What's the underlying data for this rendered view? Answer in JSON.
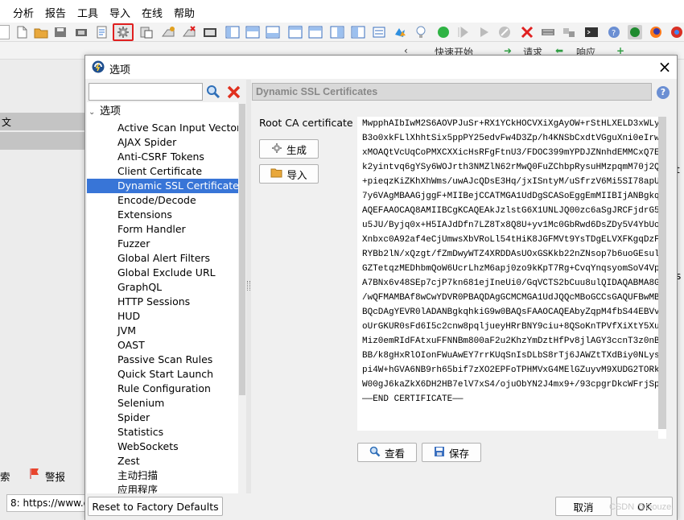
{
  "menu": [
    "分析",
    "报告",
    "工具",
    "导入",
    "在线",
    "帮助"
  ],
  "toolbar_icons": [
    "new-session-icon",
    "open-session-icon",
    "save-session-icon",
    "snapshot-icon",
    "session-props-icon",
    "options-icon",
    "export-icon",
    "add-alert-icon",
    "remove-alert-icon",
    "terminal-icon",
    "layout-1-icon",
    "layout-2-icon",
    "layout-3-icon",
    "layout-4-icon",
    "layout-5-icon",
    "layout-6-icon",
    "layout-7-icon",
    "scope-icon",
    "hud-icon",
    "plugin-icon",
    "bulb-icon",
    "run-icon",
    "step-icon",
    "play-icon",
    "stop-icon",
    "scissors-icon",
    "grid-icon",
    "proxy-icon",
    "console-icon",
    "help-circle-icon",
    "dot-icon",
    "firefox-icon",
    "chrome-icon"
  ],
  "bg": {
    "quickstart": "快速开始",
    "request": "请求",
    "response": "响应",
    "left_rows": [
      "文"
    ],
    "bottom_search": "索",
    "bottom_alerts": "警报",
    "url": "8: https://www.qi",
    "right_chars": [
      "t",
      "s"
    ]
  },
  "dialog": {
    "title": "选项",
    "close": "×",
    "search_placeholder": "",
    "root": "选项",
    "items": [
      "Active Scan Input Vectors",
      "AJAX Spider",
      "Anti-CSRF Tokens",
      "Client Certificate",
      "Dynamic SSL Certificates",
      "Encode/Decode",
      "Extensions",
      "Form Handler",
      "Fuzzer",
      "Global Alert Filters",
      "Global Exclude URL",
      "GraphQL",
      "HTTP Sessions",
      "HUD",
      "JVM",
      "OAST",
      "Passive Scan Rules",
      "Quick Start Launch",
      "Rule Configuration",
      "Selenium",
      "Spider",
      "Statistics",
      "WebSockets",
      "Zest",
      "主动扫描",
      "应用程序"
    ],
    "selected_index": 4,
    "panel_title": "Dynamic SSL Certificates",
    "help": "?",
    "root_ca_label": "Root CA certificate",
    "generate": "生成",
    "import": "导入",
    "view": "查看",
    "save": "保存",
    "reset": "Reset to Factory Defaults",
    "cancel": "取消",
    "ok": "OK",
    "cert_lines": [
      "MwpphAIbIwM2S6AOVPJuSr+RX1YCkHOCVXiXgAyOW+rStHLXELD3xWLyOXCiq",
      "B3o0xkFLlXhhtSix5ppPY25edvFw4D3Zp/h4KNSbCxdtVGguXni0eIrwkYUxW",
      "xMOAQtVcUqCoPMXCXXicHsRFgFtnU3/FDOC399mYPDJZNnhdEMMCxQ7EZIqRv",
      "k2yintvq6gYSy6WOJrth3NMZlN62rMwQ0FuZChbpRysuHMzpqmM70j2QqlPtG",
      "+pieqzKiZKhXhWms/uwAJcQDsE3Hq/jxISntyM/uSfrzV6Mi5SI78apUJNLZ",
      "7y6VAgMBAAGjggF+MIIBejCCATMGA1UdDgSCASoEggEmMIIBIjANBgkqhkiG9",
      "AQEFAAOCAQ8AMIIBCgKCAQEAkJzlstG6X1UNLJQ00zc6aSgJRCFjdrG56L67H",
      "u5JU/Byjq0x+H5IAJdDfn7LZ8Tx8Q8U+yv1Mc0GbRwd6DsZDy5V4YbUoseaaT",
      "Xnbxc0A92af4eCjUmwsXbVRoLl54tHiK8JGFMVt9YsTDgELVXFKgqDzFwl14n",
      "RYBb2lN/xQzgt/fZmDwyWTZ4XRDDAsUOxGSKkb22nZNsop7b6uoGEsultCa7Y",
      "GZTetqzMEDhbmQoW6UcrLhzM6apj0zo9kKpT7Rg+CvqYnqsyomSoV4VprP7sA",
      "A7BNx6v48SEp7cjP7kn681ejIneUi0/GqVCTS2bCuu8ulQIDAQABMA8GA1UdE",
      "/wQFMAMBAf8wCwYDVR0PBAQDAgGCMCMGA1UdJQQcMBoGCCsGAQUFBwMBBggrB",
      "BQcDAgYEVR0lADANBgkqhkiG9w0BAQsFAAOCAQEAbyZqpM4fbS44EBVvkEg5j",
      "oUrGKUR0sFd6I5c2cnw8pqljueyHRrBNY9ciu+8QSoKnTPVfXiXtY5XuMdsaR",
      "Miz0emRIdFAtxuFFNNBm800aF2u2KhzYmDztHfPv8jlAGY3ccnT3z0nBv/LD",
      "BB/k8gHxRlOIonFWuAwEY7rrKUqSnIsDLbS8rTj6JAWZtTXdBiy0NLysJhwFt",
      "pi4W+hGVA6NB9rh65bif7zXO2EPFoTPHMVxG4MElGZuyvM9XUDG2TORkjw5p",
      "W00gJ6kaZkX6DH2HB7elV7xS4/ojuObYN2J4mx9+/93cpgrDkcWFrjSpCajVy",
      "——END CERTIFICATE——"
    ]
  },
  "watermark": "CSDN @Douze.",
  "colors": {
    "selection": "#3875d7",
    "highlight_border": "#e02020",
    "clear_red": "#e0301e"
  }
}
